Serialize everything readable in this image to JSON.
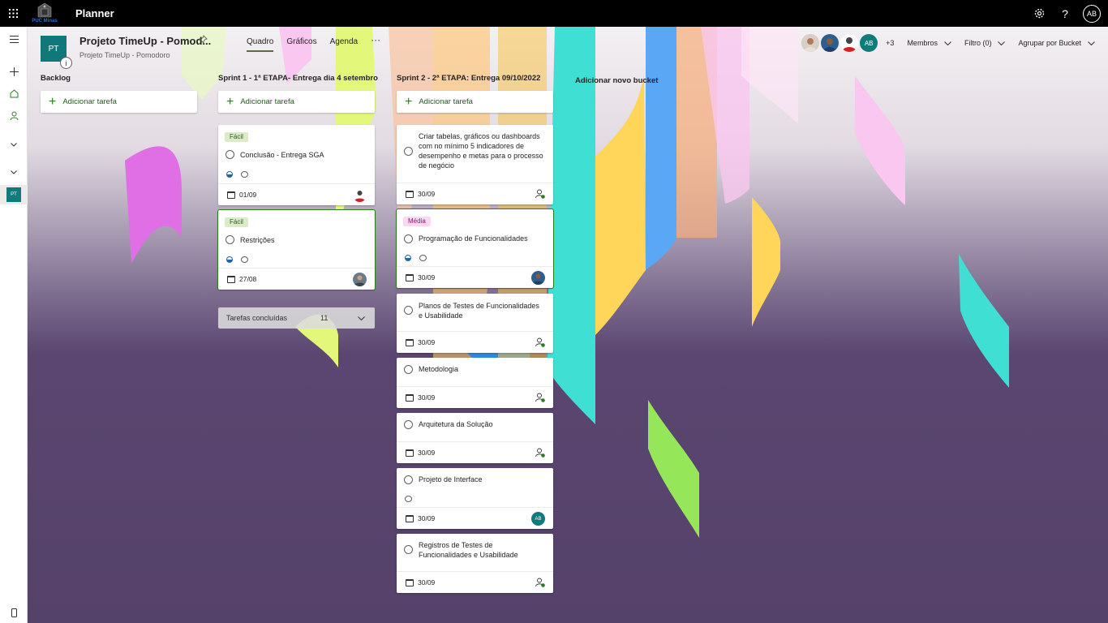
{
  "topbar": {
    "logo_text": "PUC Minas",
    "app_name": "Planner",
    "settings_icon": "gear-icon",
    "help_label": "?",
    "user_initials": "AB"
  },
  "plan": {
    "icon_initials": "PT",
    "title": "Projeto TimeUp - Pomod...",
    "subtitle": "Projeto TimeUp - Pomodoro",
    "info_label": "i",
    "tabs": [
      {
        "label": "Quadro",
        "active": true
      },
      {
        "label": "Gráficos",
        "active": false
      },
      {
        "label": "Agenda",
        "active": false
      }
    ],
    "more_label": "···",
    "members": {
      "initials_avatar": "AB",
      "more_count": "+3",
      "members_label": "Membros",
      "filter_label": "Filtro (0)",
      "group_label": "Agrupar por Bucket"
    }
  },
  "rail": {
    "plan_initials": "PT"
  },
  "buckets": [
    {
      "title": "Backlog",
      "add_label": "Adicionar tarefa",
      "tasks": []
    },
    {
      "title": "Sprint 1 - 1ª ETAPA- Entrega dia 4 setembro",
      "add_label": "Adicionar tarefa",
      "tasks": [
        {
          "label": "Fácil",
          "title": "Conclusão - Entrega SGA",
          "date": "01/09"
        },
        {
          "label": "Fácil",
          "title": "Restrições",
          "date": "27/08"
        }
      ],
      "completed": {
        "label": "Tarefas concluídas",
        "count": "11"
      }
    },
    {
      "title": "Sprint 2 - 2ª ETAPA: Entrega 09/10/2022",
      "add_label": "Adicionar tarefa",
      "tasks": [
        {
          "title": "Criar tabelas, gráficos ou dashboards com no mínimo 5 indicadores de desempenho e metas para o processo de negócio",
          "date": "30/09"
        },
        {
          "label": "Média",
          "title": "Programação de Funcionalidades",
          "date": "30/09"
        },
        {
          "title": "Planos de Testes de Funcionalidades e Usabilidade",
          "date": "30/09"
        },
        {
          "title": "Metodologia",
          "date": "30/09"
        },
        {
          "title": "Arquitetura da Solução",
          "date": "30/09"
        },
        {
          "title": "Projeto de Interface",
          "date": "30/09",
          "assignee": "AB"
        },
        {
          "title": "Registros de Testes de Funcionalidades e Usabilidade",
          "date": "30/09"
        }
      ]
    }
  ],
  "new_bucket_label": "Adicionar novo bucket",
  "colors": {
    "background": "#55426a",
    "accent": "#2f7b24",
    "plan_tile": "#10777a"
  }
}
